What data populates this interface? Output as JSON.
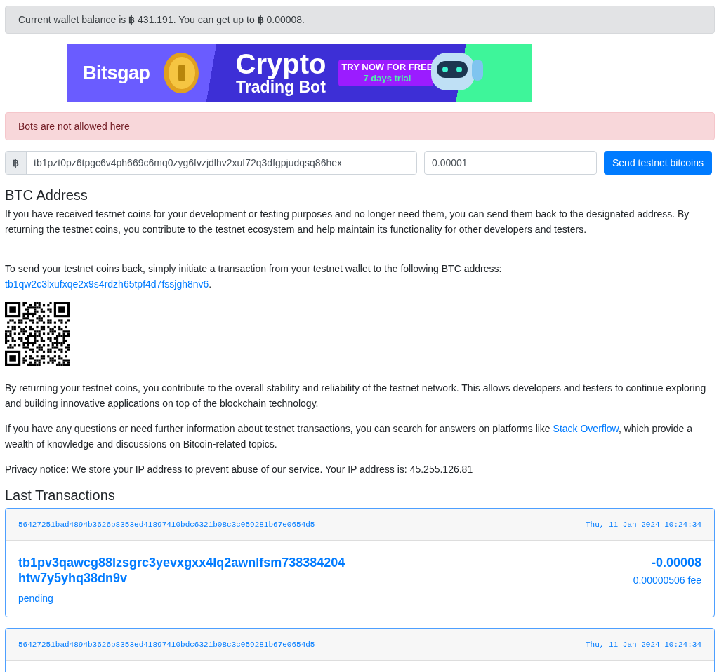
{
  "balance_alert": {
    "text": "Current wallet balance is **฿** 431.191. You can get up to **฿** 0.00008."
  },
  "banner": {
    "brand": "Bitsgap",
    "headline": "Crypto",
    "subline": "Trading Bot",
    "cta": "TRY NOW FOR FREE",
    "cta_note": "7 days trial"
  },
  "bot_alert": {
    "text": "Bots are not allowed here"
  },
  "send_form": {
    "currency_symbol": "฿",
    "address": "tb1pzt0pz6tpgc6v4ph669c6mq0zyg6fvzjdlhv2xuf72q3dfgpjudqsq86hex",
    "amount": "0.00001",
    "button": "Send testnet bitcoins"
  },
  "btc_address": {
    "heading": "BTC Address",
    "intro": "If you have received testnet coins for your development or testing purposes and no longer need them, you can send them back to the designated address. By returning the testnet coins, you contribute to the testnet ecosystem and help maintain its functionality for other developers and testers.",
    "instruction": "To send your testnet coins back, simply initiate a transaction from your testnet wallet to the following BTC address:",
    "address": "tb1qw2c3lxufxqe2x9s4rdzh65tpf4d7fssjgh8nv6",
    "address_suffix": ".",
    "closing": "By returning your testnet coins, you contribute to the overall stability and reliability of the testnet network. This allows developers and testers to continue exploring and building innovative applications on top of the blockchain technology.",
    "questions": {
      "before": "If you have any questions or need further information about testnet transactions, you can search for answers on platforms like ",
      "link": "Stack Overflow",
      "after": ", which provide a wealth of knowledge and discussions on Bitcoin-related topics."
    },
    "privacy": "Privacy notice: We store your IP address to prevent abuse of our service. Your IP address is: 45.255.126.81"
  },
  "transactions": {
    "heading": "Last Transactions",
    "items": [
      {
        "txid": "56427251bad4894b3626b8353ed41897410bdc6321b08c3c059281b67e0654d5",
        "time": "Thu, 11 Jan 2024 10:24:34",
        "address": "tb1pv3qawcg88lzsgrc3yevxgxx4lq2awnlfsm738384204htw7y5yhq38dn9v",
        "amount": "-0.00008",
        "fee": "0.00000506 fee",
        "status": "pending"
      },
      {
        "txid": "56427251bad4894b3626b8353ed41897410bdc6321b08c3c059281b67e0654d5",
        "time": "Thu, 11 Jan 2024 10:24:34"
      }
    ]
  }
}
